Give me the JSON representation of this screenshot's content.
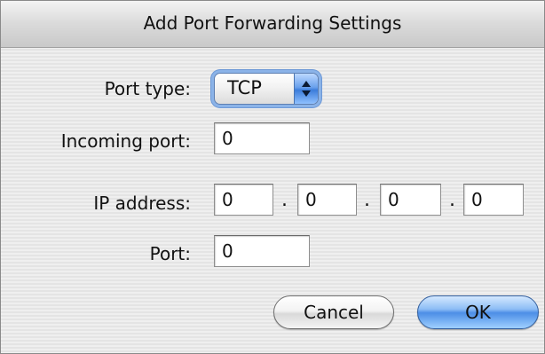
{
  "dialog": {
    "title": "Add Port Forwarding Settings"
  },
  "form": {
    "port_type": {
      "label": "Port type:",
      "selected": "TCP"
    },
    "incoming_port": {
      "label": "Incoming port:",
      "value": "0"
    },
    "ip_address": {
      "label": "IP address:",
      "separator": ".",
      "octets": [
        "0",
        "0",
        "0",
        "0"
      ]
    },
    "port": {
      "label": "Port:",
      "value": "0"
    }
  },
  "buttons": {
    "cancel_label": "Cancel",
    "ok_label": "OK"
  },
  "colors": {
    "focus_ring": "#8bb3e8",
    "default_button": "#4c8ee6",
    "window_background": "#ececec"
  }
}
